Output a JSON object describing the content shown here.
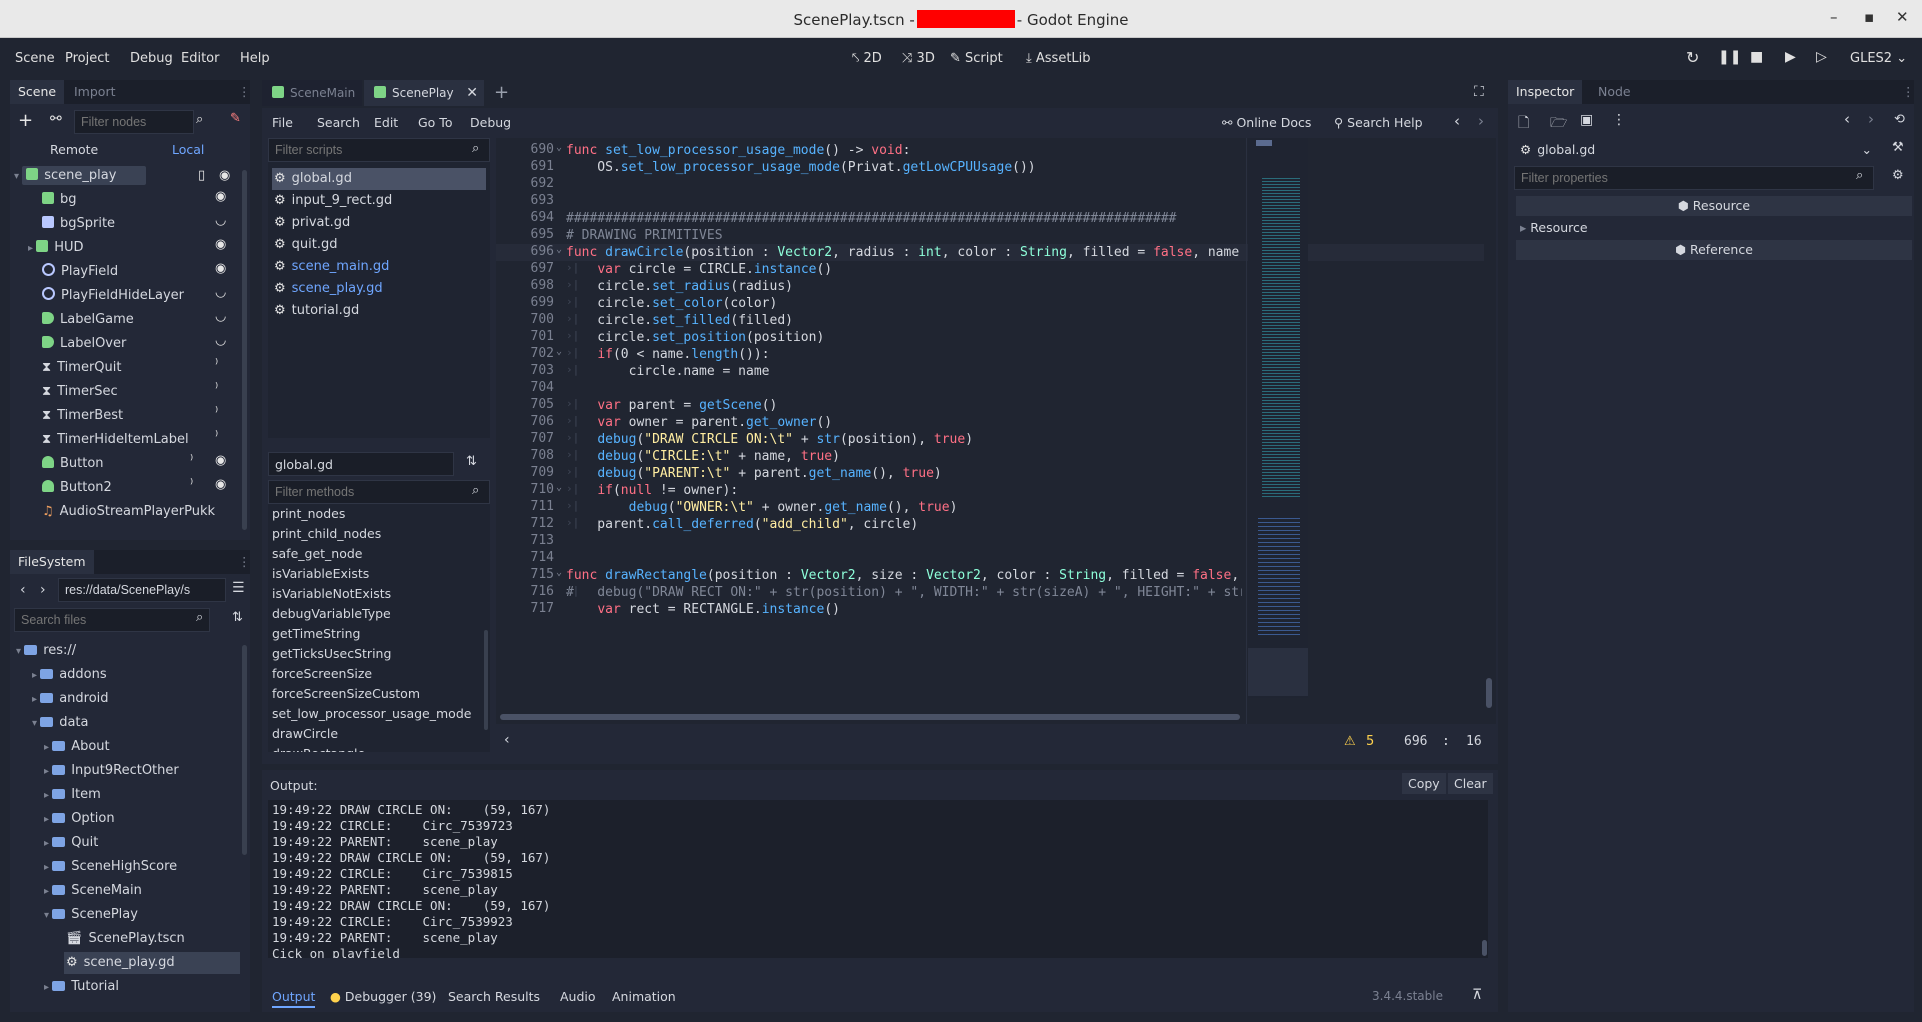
{
  "window": {
    "title_prefix": "ScenePlay.tscn -",
    "title_suffix": "- Godot Engine",
    "controls": {
      "minimize": "–",
      "maximize": "▪",
      "close": "✕"
    }
  },
  "menu": {
    "items": [
      "Scene",
      "Project",
      "Debug",
      "Editor",
      "Help"
    ],
    "workspaces": [
      "2D",
      "3D",
      "Script",
      "AssetLib"
    ],
    "renderer": "GLES2",
    "icon_2d": "2D",
    "icon_3d": "3D"
  },
  "scene_dock": {
    "tabs": [
      "Scene",
      "Import"
    ],
    "filter_placeholder": "Filter nodes",
    "remote": "Remote",
    "local": "Local",
    "nodes": [
      {
        "name": "scene_play",
        "icon": "sq-green"
      },
      {
        "name": "bg",
        "icon": "sq-green"
      },
      {
        "name": "bgSprite",
        "icon": "sq-green"
      },
      {
        "name": "HUD",
        "icon": "sq-green"
      },
      {
        "name": "PlayField",
        "icon": "circle"
      },
      {
        "name": "PlayFieldHideLayer",
        "icon": "circle"
      },
      {
        "name": "LabelGame",
        "icon": "label"
      },
      {
        "name": "LabelOver",
        "icon": "label"
      },
      {
        "name": "TimerQuit",
        "icon": "timer"
      },
      {
        "name": "TimerSec",
        "icon": "timer"
      },
      {
        "name": "TimerBest",
        "icon": "timer"
      },
      {
        "name": "TimerHideItemLabel",
        "icon": "timer"
      },
      {
        "name": "Button",
        "icon": "button"
      },
      {
        "name": "Button2",
        "icon": "button"
      },
      {
        "name": "AudioStreamPlayerPukk",
        "icon": "audio"
      }
    ]
  },
  "filesystem": {
    "title": "FileSystem",
    "path": "res://data/ScenePlay/s",
    "search_placeholder": "Search files",
    "items": [
      {
        "name": "res://",
        "depth": 0
      },
      {
        "name": "addons",
        "depth": 1
      },
      {
        "name": "android",
        "depth": 1
      },
      {
        "name": "data",
        "depth": 1
      },
      {
        "name": "About",
        "depth": 2
      },
      {
        "name": "Input9RectOther",
        "depth": 2
      },
      {
        "name": "Item",
        "depth": 2
      },
      {
        "name": "Option",
        "depth": 2
      },
      {
        "name": "Quit",
        "depth": 2
      },
      {
        "name": "SceneHighScore",
        "depth": 2
      },
      {
        "name": "SceneMain",
        "depth": 2
      },
      {
        "name": "ScenePlay",
        "depth": 2
      },
      {
        "name": "ScenePlay.tscn",
        "depth": 3
      },
      {
        "name": "scene_play.gd",
        "depth": 3
      },
      {
        "name": "Tutorial",
        "depth": 2
      }
    ]
  },
  "editor_tabs": [
    "SceneMain",
    "ScenePlay"
  ],
  "script_menu": [
    "File",
    "Search",
    "Edit",
    "Go To",
    "Debug"
  ],
  "script_tools": {
    "online_docs": "Online Docs",
    "search_help": "Search Help"
  },
  "scripts": {
    "filter_placeholder": "Filter scripts",
    "list": [
      "global.gd",
      "input_9_rect.gd",
      "privat.gd",
      "quit.gd",
      "scene_main.gd",
      "scene_play.gd",
      "tutorial.gd"
    ],
    "current": "global.gd",
    "methods_placeholder": "Filter methods",
    "methods": [
      "print_nodes",
      "print_child_nodes",
      "safe_get_node",
      "isVariableExists",
      "isVariableNotExists",
      "debugVariableType",
      "getTimeString",
      "getTicksUsecString",
      "forceScreenSize",
      "forceScreenSizeCustom",
      "set_low_processor_usage_mode",
      "drawCircle",
      "drawRectangle"
    ]
  },
  "code": {
    "line_numbers": [
      "690",
      "691",
      "692",
      "693",
      "694",
      "695",
      "696",
      "697",
      "698",
      "699",
      "700",
      "701",
      "702",
      "703",
      "704",
      "705",
      "706",
      "707",
      "708",
      "709",
      "710",
      "711",
      "712",
      "713",
      "714",
      "715",
      "716",
      "717"
    ],
    "lines": [
      "func set_low_processor_usage_mode() -> void:",
      "    OS.set_low_processor_usage_mode(Privat.getLowCPUUsage())",
      "",
      "",
      "##############################################################################",
      "# DRAWING PRIMITIVES",
      "func drawCircle(position : Vector2, radius : int, color : String, filled = false, name = \"\") -> void:",
      "    var circle = CIRCLE.instance()",
      "    circle.set_radius(radius)",
      "    circle.set_color(color)",
      "    circle.set_filled(filled)",
      "    circle.set_position(position)",
      "    if(0 < name.length()):",
      "        circle.name = name",
      "",
      "    var parent = getScene()",
      "    var owner = parent.get_owner()",
      "    debug(\"DRAW CIRCLE ON:\\t\" + str(position), true)",
      "    debug(\"CIRCLE:\\t\" + name, true)",
      "    debug(\"PARENT:\\t\" + parent.get_name(), true)",
      "    if(null != owner):",
      "        debug(\"OWNER:\\t\" + owner.get_name(), true)",
      "    parent.call_deferred(\"add_child\", circle)",
      "",
      "",
      "func drawRectangle(position : Vector2, size : Vector2, color : String, filled = false, name = \"\") -> vo",
      "#   debug(\"DRAW RECT ON:\" + str(position) + \", WIDTH:\" + str(sizeA) + \", HEIGHT:\" + str(sizeB))",
      "    var rect = RECTANGLE.instance()"
    ],
    "warnings": "5",
    "cursor_line": "696",
    "cursor_sep": ":",
    "cursor_col": "16"
  },
  "output": {
    "label": "Output:",
    "copy": "Copy",
    "clear": "Clear",
    "lines": [
      "19:49:22 DRAW CIRCLE ON:    (59, 167)",
      "19:49:22 CIRCLE:    Circ_7539723",
      "19:49:22 PARENT:    scene_play",
      "19:49:22 DRAW CIRCLE ON:    (59, 167)",
      "19:49:22 CIRCLE:    Circ_7539815",
      "19:49:22 PARENT:    scene_play",
      "19:49:22 DRAW CIRCLE ON:    (59, 167)",
      "19:49:22 CIRCLE:    Circ_7539923",
      "19:49:22 PARENT:    scene_play",
      "Cick on playfield"
    ]
  },
  "bottom_tabs": [
    "Output",
    "Debugger (39)",
    "Search Results",
    "Audio",
    "Animation"
  ],
  "version": "3.4.4.stable",
  "inspector": {
    "tabs": [
      "Inspector",
      "Node"
    ],
    "object": "global.gd",
    "filter_placeholder": "Filter properties",
    "section_resource": "Resource",
    "row_resource": "Resource",
    "section_reference": "Reference"
  },
  "colors": {
    "accent": "#6fa6ff",
    "keyword": "#ff7085",
    "function": "#57b3ff",
    "type": "#8effda",
    "string": "#ffeda1",
    "comment": "#808797"
  }
}
